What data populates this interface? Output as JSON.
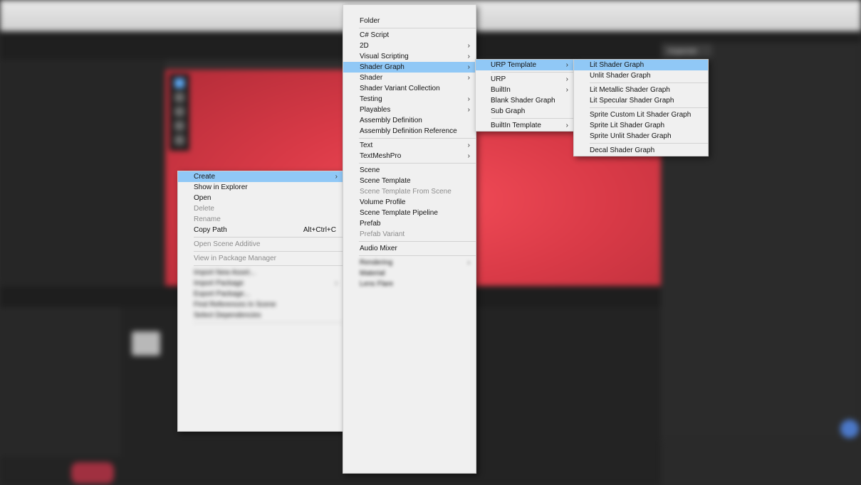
{
  "editor": {
    "window_title": "",
    "inspector_tab_label": "Inspector"
  },
  "create_menu": {
    "items": [
      {
        "label": "Create",
        "submenu": true,
        "highlighted": true
      },
      {
        "label": "Show in Explorer"
      },
      {
        "label": "Open"
      },
      {
        "label": "Delete",
        "disabled": true
      },
      {
        "label": "Rename",
        "disabled": true
      },
      {
        "label": "Copy Path",
        "shortcut": "Alt+Ctrl+C"
      },
      {
        "label": "Open Scene Additive",
        "disabled": true
      },
      {
        "label": "View in Package Manager",
        "disabled": true
      },
      {
        "label": "Import New Asset..."
      },
      {
        "label": "Import Package",
        "submenu": true
      },
      {
        "label": "Export Package..."
      },
      {
        "label": "Find References In Scene"
      },
      {
        "label": "Select Dependencies"
      }
    ]
  },
  "main_menu": {
    "items": [
      {
        "label": "Folder"
      },
      {
        "label": "C# Script"
      },
      {
        "label": "2D",
        "submenu": true
      },
      {
        "label": "Visual Scripting",
        "submenu": true
      },
      {
        "label": "Shader Graph",
        "submenu": true,
        "highlighted": true
      },
      {
        "label": "Shader",
        "submenu": true
      },
      {
        "label": "Shader Variant Collection"
      },
      {
        "label": "Testing",
        "submenu": true
      },
      {
        "label": "Playables",
        "submenu": true
      },
      {
        "label": "Assembly Definition"
      },
      {
        "label": "Assembly Definition Reference"
      },
      {
        "label": "Text",
        "submenu": true
      },
      {
        "label": "TextMeshPro",
        "submenu": true
      },
      {
        "label": "Scene"
      },
      {
        "label": "Scene Template"
      },
      {
        "label": "Scene Template From Scene",
        "disabled": true
      },
      {
        "label": "Volume Profile"
      },
      {
        "label": "Scene Template Pipeline"
      },
      {
        "label": "Prefab"
      },
      {
        "label": "Prefab Variant",
        "disabled": true
      },
      {
        "label": "Audio Mixer"
      },
      {
        "label": "Rendering",
        "submenu": true
      },
      {
        "label": "Material"
      },
      {
        "label": "Lens Flare"
      }
    ]
  },
  "urp_template_menu": {
    "items": [
      {
        "label": "URP Template",
        "submenu": true,
        "highlighted": true
      },
      {
        "label": "URP",
        "submenu": true
      },
      {
        "label": "BuiltIn",
        "submenu": true
      },
      {
        "label": "Blank Shader Graph"
      },
      {
        "label": "Sub Graph"
      },
      {
        "label": "BuiltIn Template",
        "submenu": true
      }
    ]
  },
  "shader_graph_menu": {
    "items": [
      {
        "label": "Lit Shader Graph",
        "highlighted": true
      },
      {
        "label": "Unlit Shader Graph"
      },
      {
        "label": "Lit Metallic Shader Graph"
      },
      {
        "label": "Lit Specular Shader Graph"
      },
      {
        "label": "Sprite Custom Lit Shader Graph"
      },
      {
        "label": "Sprite Lit Shader Graph"
      },
      {
        "label": "Sprite Unlit Shader Graph"
      },
      {
        "label": "Decal Shader Graph"
      }
    ]
  },
  "colors": {
    "menu_bg": "#f0f0f0",
    "highlight": "#90c8f6",
    "scene_red": "#e8434f"
  }
}
